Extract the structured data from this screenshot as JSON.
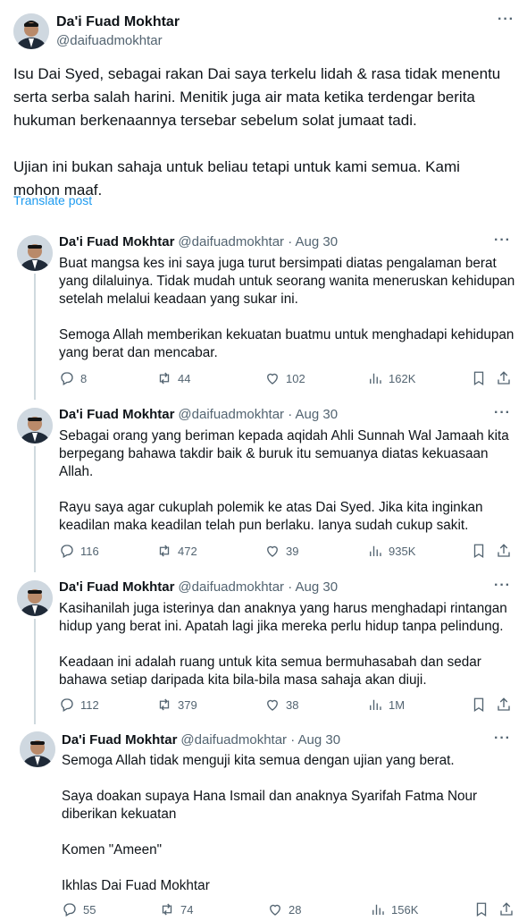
{
  "main_post": {
    "author_name": "Da'i Fuad Mokhtar",
    "author_handle": "@daifuadmokhtar",
    "more_label": "···",
    "text": "Isu Dai Syed, sebagai rakan Dai saya terkelu lidah & rasa tidak menentu\nserta serba salah harini. Menitik juga air mata ketika terdengar berita\nhukuman berkenaannya tersebar sebelum solat jumaat tadi.\n\nUjian ini bukan sahaja untuk beliau tetapi untuk kami semua. Kami\nmohon maaf.",
    "translate_label": "Translate post"
  },
  "replies": [
    {
      "author_name": "Da'i Fuad Mokhtar",
      "meta": "@daifuadmokhtar · Aug 30",
      "text": "Buat mangsa kes ini saya juga turut bersimpati diatas pengalaman berat\nyang dilaluinya. Tidak mudah untuk seorang wanita meneruskan kehidupan\nsetelah melalui keadaan yang sukar ini.\n\nSemoga Allah memberikan kekuatan buatmu untuk menghadapi kehidupan\nyang berat dan mencabar.",
      "replies": "8",
      "reposts": "44",
      "likes": "102",
      "views": "162K"
    },
    {
      "author_name": "Da'i Fuad Mokhtar",
      "meta": "@daifuadmokhtar · Aug 30",
      "text": "Sebagai orang yang beriman kepada aqidah Ahli Sunnah Wal Jamaah kita\nberpegang bahawa takdir baik & buruk itu semuanya diatas kekuasaan\nAllah.\n\nRayu saya agar cukuplah polemik ke atas Dai Syed. Jika kita inginkan\nkeadilan maka keadilan telah pun berlaku. Ianya sudah cukup sakit.",
      "replies": "116",
      "reposts": "472",
      "likes": "39",
      "views": "935K"
    },
    {
      "author_name": "Da'i Fuad Mokhtar",
      "meta": "@daifuadmokhtar · Aug 30",
      "text": "Kasihanilah juga isterinya dan anaknya yang harus menghadapi rintangan\nhidup yang berat ini. Apatah lagi jika mereka perlu hidup tanpa pelindung.\n\nKeadaan ini adalah ruang untuk kita semua bermuhasabah dan sedar\nbahawa setiap daripada kita bila-bila masa sahaja akan diuji.",
      "replies": "112",
      "reposts": "379",
      "likes": "38",
      "views": "1M"
    },
    {
      "author_name": "Da'i Fuad Mokhtar",
      "meta": "@daifuadmokhtar · Aug 30",
      "text": "Semoga Allah tidak menguji kita semua dengan ujian yang berat.\n\nSaya doakan supaya Hana Ismail dan anaknya Syarifah Fatma Nour\ndiberikan kekuatan\n\nKomen \"Ameen\"\n\nIkhlas Dai Fuad Mokhtar",
      "replies": "55",
      "reposts": "74",
      "likes": "28",
      "views": "156K"
    }
  ],
  "colors": {
    "text": "#0f1419",
    "secondary": "#536471",
    "link": "#1d9bf0",
    "thread_line": "#cfd9de"
  },
  "icons": [
    "reply-icon",
    "repost-icon",
    "like-icon",
    "views-icon",
    "bookmark-icon",
    "share-icon",
    "more-icon"
  ]
}
